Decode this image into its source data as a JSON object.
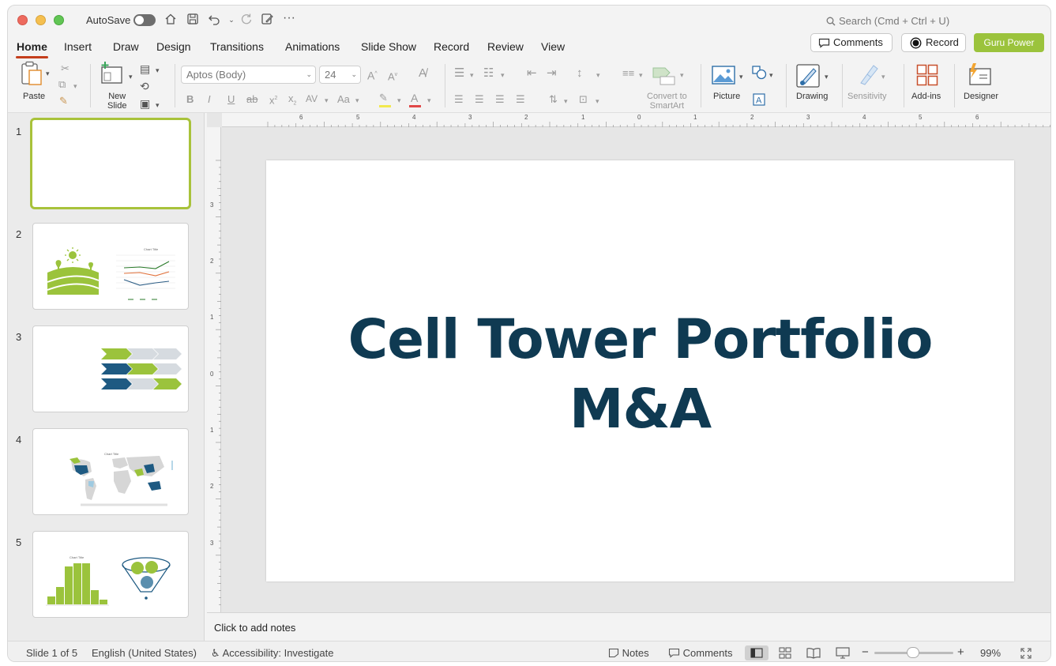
{
  "titlebar": {
    "autosave_label": "AutoSave",
    "search_placeholder": "Search (Cmd + Ctrl + U)"
  },
  "tabs": [
    {
      "label": "Home",
      "active": true
    },
    {
      "label": "Insert"
    },
    {
      "label": "Draw"
    },
    {
      "label": "Design"
    },
    {
      "label": "Transitions"
    },
    {
      "label": "Animations"
    },
    {
      "label": "Slide Show"
    },
    {
      "label": "Record"
    },
    {
      "label": "Review"
    },
    {
      "label": "View"
    }
  ],
  "header_buttons": {
    "comments": "Comments",
    "record": "Record",
    "guru": "Guru Power"
  },
  "ribbon": {
    "paste": "Paste",
    "new_slide_line1": "New",
    "new_slide_line2": "Slide",
    "font_name": "Aptos (Body)",
    "font_size": "24",
    "smartart_line1": "Convert to",
    "smartart_line2": "SmartArt",
    "picture": "Picture",
    "drawing": "Drawing",
    "sensitivity": "Sensitivity",
    "addins": "Add-ins",
    "designer": "Designer"
  },
  "thumbnails": [
    {
      "number": "1"
    },
    {
      "number": "2",
      "chart_title": "Chart Title"
    },
    {
      "number": "3"
    },
    {
      "number": "4",
      "chart_title": "Chart Title"
    },
    {
      "number": "5",
      "chart_title": "Chart Title"
    }
  ],
  "ruler": {
    "h_labels": [
      "6",
      "5",
      "4",
      "3",
      "2",
      "1",
      "0",
      "1",
      "2",
      "3",
      "4",
      "5",
      "6"
    ],
    "v_labels": [
      "3",
      "2",
      "1",
      "0",
      "1",
      "2",
      "3"
    ]
  },
  "slide": {
    "title_line1": "Cell Tower Portfolio",
    "title_line2": "M&A"
  },
  "notes_placeholder": "Click to add notes",
  "status": {
    "slide_counter": "Slide 1 of 5",
    "language": "English (United States)",
    "accessibility": "Accessibility: Investigate",
    "notes": "Notes",
    "comments": "Comments",
    "zoom": "99%"
  },
  "colors": {
    "accent_green": "#9bc33c",
    "title_navy": "#0f3a52",
    "tab_underline": "#c43e1c"
  }
}
